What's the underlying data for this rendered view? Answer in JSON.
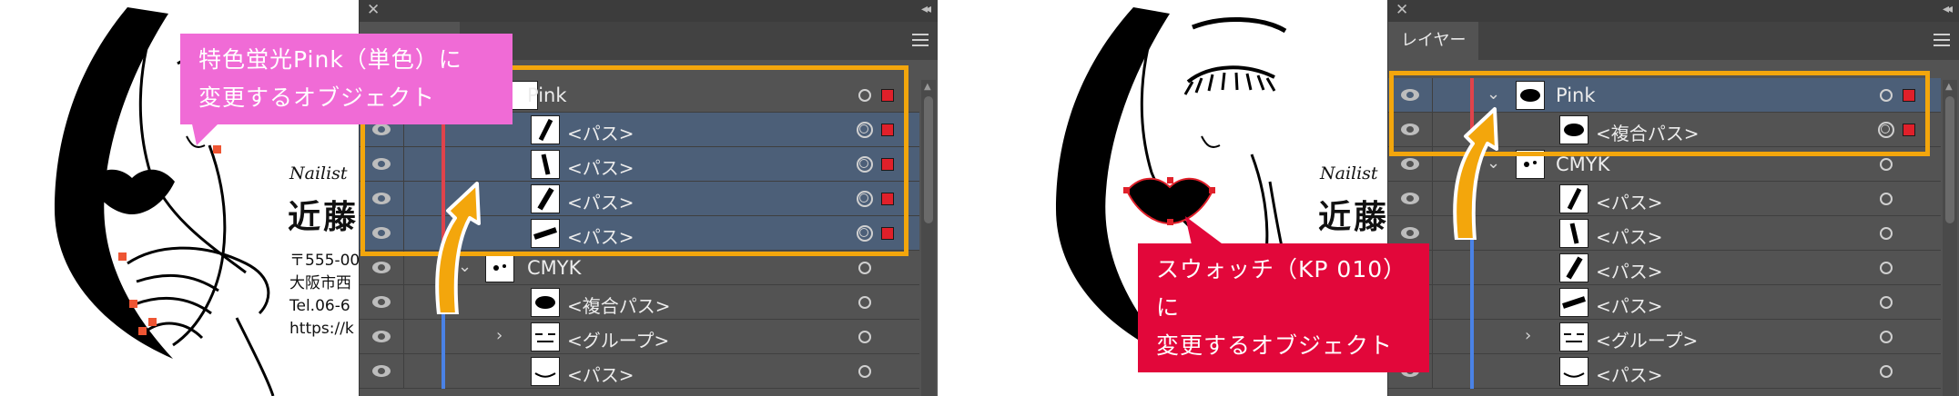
{
  "left_panel": {
    "layers": [
      {
        "id": "pink",
        "label": "Pink",
        "type": "layer"
      },
      {
        "id": "p1",
        "label": "<パス>"
      },
      {
        "id": "p2",
        "label": "<パス>"
      },
      {
        "id": "p3",
        "label": "<パス>"
      },
      {
        "id": "p4",
        "label": "<パス>"
      },
      {
        "id": "cmyk",
        "label": "CMYK",
        "type": "layer"
      },
      {
        "id": "c1",
        "label": "<複合パス>"
      },
      {
        "id": "c2",
        "label": "<グループ>"
      },
      {
        "id": "c3",
        "label": "<パス>"
      }
    ],
    "callout_text_line1": "特色蛍光Pink（単色）に",
    "callout_text_line2": "変更するオブジェクト"
  },
  "right_panel": {
    "tab_label": "レイヤー",
    "layers": [
      {
        "id": "pink",
        "label": "Pink",
        "type": "layer"
      },
      {
        "id": "comp",
        "label": "<複合パス>"
      },
      {
        "id": "cmyk",
        "label": "CMYK",
        "type": "layer"
      },
      {
        "id": "p1",
        "label": "<パス>"
      },
      {
        "id": "p2",
        "label": "<パス>"
      },
      {
        "id": "p3",
        "label": "<パス>"
      },
      {
        "id": "p4",
        "label": "<パス>"
      },
      {
        "id": "grp",
        "label": "<グループ>"
      },
      {
        "id": "p5",
        "label": "<パス>"
      }
    ],
    "callout_text_line1": "スウォッチ（KP 010）に",
    "callout_text_line2": "変更するオブジェクト"
  },
  "card": {
    "title": "Nailist",
    "name_left": "近藤",
    "name_right": "近藤",
    "address_lines": [
      "〒555-00",
      "大阪市西",
      "Tel.06-6",
      " https://k"
    ]
  },
  "colors": {
    "highlight": "#f3a60c",
    "callout_pink": "#f06bd6",
    "callout_red": "#e2073a",
    "selection_blue": "#4c5f78",
    "panel_bg": "#535353",
    "pink_layer_color": "#e0434b",
    "cmyk_layer_color": "#4a82e6"
  }
}
